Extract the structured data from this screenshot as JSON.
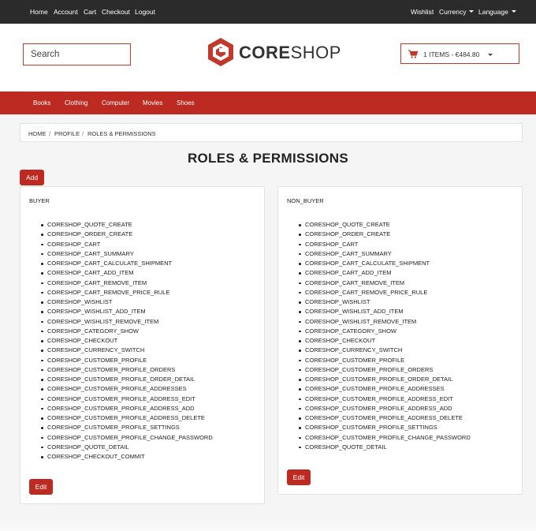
{
  "top_nav": {
    "left": [
      "Home",
      "Account",
      "Cart",
      "Checkout",
      "Logout"
    ],
    "wishlist": "Wishlist",
    "currency": "Currency",
    "language": "Language"
  },
  "header": {
    "search_placeholder": "Search",
    "logo_bold": "CORE",
    "logo_light": "SHOP",
    "cart_label": "1 ITEMS - €484.80",
    "brand_color": "#bd2a21"
  },
  "categories": [
    "Books",
    "Clothing",
    "Computer",
    "Movies",
    "Shoes"
  ],
  "breadcrumb": [
    "HOME",
    "PROFILE",
    "ROLES & PERMISSIONS"
  ],
  "page_title": "ROLES & PERMISSIONS",
  "add_label": "Add",
  "edit_label": "Edit",
  "roles": [
    {
      "name": "BUYER",
      "permissions": [
        "CORESHOP_QUOTE_CREATE",
        "CORESHOP_ORDER_CREATE",
        "CORESHOP_CART",
        "CORESHOP_CART_SUMMARY",
        "CORESHOP_CART_CALCULATE_SHIPMENT",
        "CORESHOP_CART_ADD_ITEM",
        "CORESHOP_CART_REMOVE_ITEM",
        "CORESHOP_CART_REMOVE_PRICE_RULE",
        "CORESHOP_WISHLIST",
        "CORESHOP_WISHLIST_ADD_ITEM",
        "CORESHOP_WISHLIST_REMOVE_ITEM",
        "CORESHOP_CATEGORY_SHOW",
        "CORESHOP_CHECKOUT",
        "CORESHOP_CURRENCY_SWITCH",
        "CORESHOP_CUSTOMER_PROFILE",
        "CORESHOP_CUSTOMER_PROFILE_ORDERS",
        "CORESHOP_CUSTOMER_PROFILE_ORDER_DETAIL",
        "CORESHOP_CUSTOMER_PROFILE_ADDRESSES",
        "CORESHOP_CUSTOMER_PROFILE_ADDRESS_EDIT",
        "CORESHOP_CUSTOMER_PROFILE_ADDRESS_ADD",
        "CORESHOP_CUSTOMER_PROFILE_ADDRESS_DELETE",
        "CORESHOP_CUSTOMER_PROFILE_SETTINGS",
        "CORESHOP_CUSTOMER_PROFILE_CHANGE_PASSWORD",
        "CORESHOP_QUOTE_DETAIL",
        "CORESHOP_CHECKOUT_COMMIT"
      ]
    },
    {
      "name": "NON_BUYER",
      "permissions": [
        "CORESHOP_QUOTE_CREATE",
        "CORESHOP_ORDER_CREATE",
        "CORESHOP_CART",
        "CORESHOP_CART_SUMMARY",
        "CORESHOP_CART_CALCULATE_SHIPMENT",
        "CORESHOP_CART_ADD_ITEM",
        "CORESHOP_CART_REMOVE_ITEM",
        "CORESHOP_CART_REMOVE_PRICE_RULE",
        "CORESHOP_WISHLIST",
        "CORESHOP_WISHLIST_ADD_ITEM",
        "CORESHOP_WISHLIST_REMOVE_ITEM",
        "CORESHOP_CATEGORY_SHOW",
        "CORESHOP_CHECKOUT",
        "CORESHOP_CURRENCY_SWITCH",
        "CORESHOP_CUSTOMER_PROFILE",
        "CORESHOP_CUSTOMER_PROFILE_ORDERS",
        "CORESHOP_CUSTOMER_PROFILE_ORDER_DETAIL",
        "CORESHOP_CUSTOMER_PROFILE_ADDRESSES",
        "CORESHOP_CUSTOMER_PROFILE_ADDRESS_EDIT",
        "CORESHOP_CUSTOMER_PROFILE_ADDRESS_ADD",
        "CORESHOP_CUSTOMER_PROFILE_ADDRESS_DELETE",
        "CORESHOP_CUSTOMER_PROFILE_SETTINGS",
        "CORESHOP_CUSTOMER_PROFILE_CHANGE_PASSWORD",
        "CORESHOP_QUOTE_DETAIL"
      ]
    }
  ]
}
